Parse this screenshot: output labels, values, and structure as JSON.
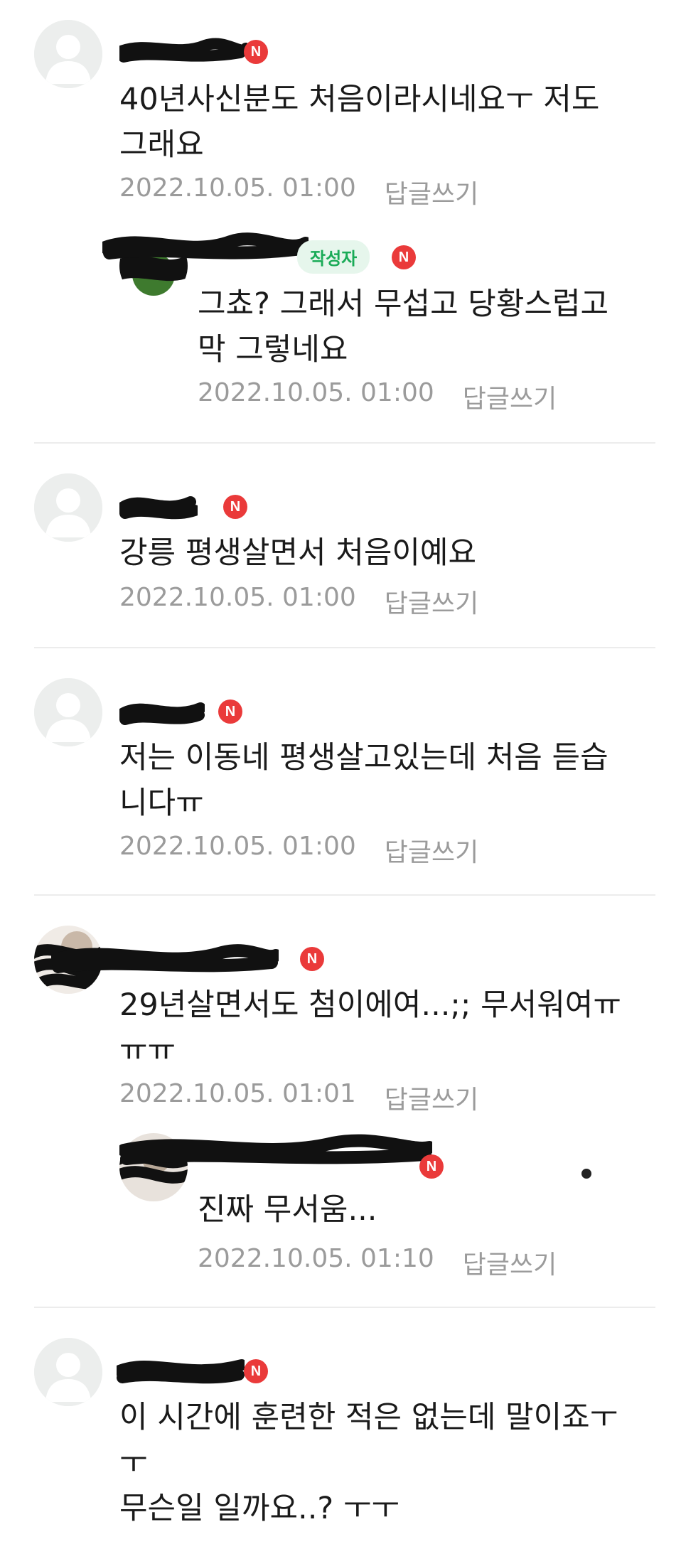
{
  "comments": [
    {
      "text": "40년사신분도 처음이라시네요ㅜ 저도\n그래요",
      "date": "2022.10.05. 01:00",
      "reply": "답글쓰기",
      "badge": "N"
    },
    {
      "text": "그쵸? 그래서 무섭고 당황스럽고\n막 그렇네요",
      "date": "2022.10.05. 01:00",
      "reply": "답글쓰기",
      "badge": "N",
      "author_tag": "작성자"
    },
    {
      "text": "강릉 평생살면서 처음이예요",
      "date": "2022.10.05. 01:00",
      "reply": "답글쓰기",
      "badge": "N"
    },
    {
      "text": "저는 이동네 평생살고있는데 처음 듣습\n니다ㅠ",
      "date": "2022.10.05. 01:00",
      "reply": "답글쓰기",
      "badge": "N"
    },
    {
      "text": "29년살면서도 첨이에여...;; 무서워여ㅠ\nㅠㅠ",
      "date": "2022.10.05. 01:01",
      "reply": "답글쓰기",
      "badge": "N"
    },
    {
      "text": "진짜 무서움...",
      "date": "2022.10.05. 01:10",
      "reply": "답글쓰기",
      "badge": "N"
    },
    {
      "text": "이 시간에 훈련한 적은 없는데 말이죠ㅜ\nㅜ\n무슨일 일까요..? ㅜㅜ",
      "badge": "N"
    }
  ],
  "colors": {
    "badge": "#ea3a3a",
    "author_tag_bg": "#e6f6ec",
    "author_tag_text": "#1aab57",
    "meta": "#9b9b9b"
  },
  "icons": {
    "default_avatar": "person-icon",
    "new_badge": "new-badge-icon"
  }
}
